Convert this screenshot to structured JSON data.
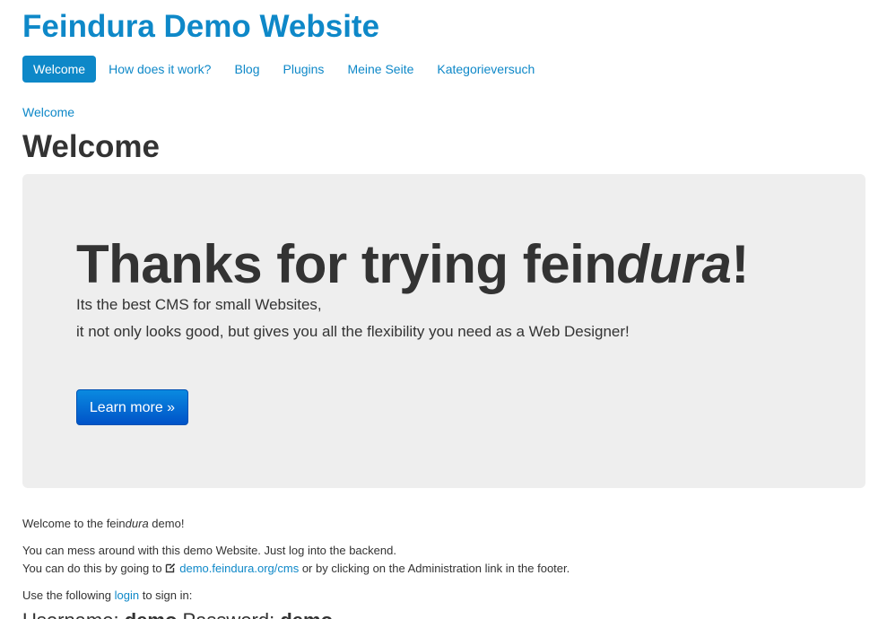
{
  "site": {
    "title": "Feindura Demo Website"
  },
  "nav": {
    "items": [
      {
        "label": "Welcome",
        "active": true
      },
      {
        "label": "How does it work?",
        "active": false
      },
      {
        "label": "Blog",
        "active": false
      },
      {
        "label": "Plugins",
        "active": false
      },
      {
        "label": "Meine Seite",
        "active": false
      },
      {
        "label": "Kategorieversuch",
        "active": false
      }
    ]
  },
  "breadcrumb": {
    "label": "Welcome"
  },
  "page": {
    "title": "Welcome"
  },
  "hero": {
    "heading_pre": "Thanks for trying fein",
    "heading_em": "dura",
    "heading_post": "!",
    "line1": "Its the best CMS for small Websites,",
    "line2": "it not only looks good, but gives you all the flexibility you need as a Web Designer!",
    "button_label": "Learn more »"
  },
  "content": {
    "intro_pre": "Welcome to the fein",
    "intro_em": "dura",
    "intro_post": " demo!",
    "para1_line1": "You can mess around with this demo Website. Just log into the backend.",
    "para1_line2_pre": "You can do this by going to ",
    "para1_link": "demo.feindura.org/cms",
    "para1_line2_post": " or by clicking on the Administration link in the footer.",
    "para2_pre": "Use the following ",
    "para2_link": "login",
    "para2_post": " to sign in:",
    "cutoff_heading_pre": "Username: ",
    "cutoff_heading_user": "demo",
    "cutoff_heading_mid": " Password: ",
    "cutoff_heading_pass": "demo"
  },
  "colors": {
    "link": "#0e88c8",
    "hero_bg": "#eeeeee",
    "button": "#0053c8"
  },
  "icons": {
    "edit": "edit-icon"
  }
}
